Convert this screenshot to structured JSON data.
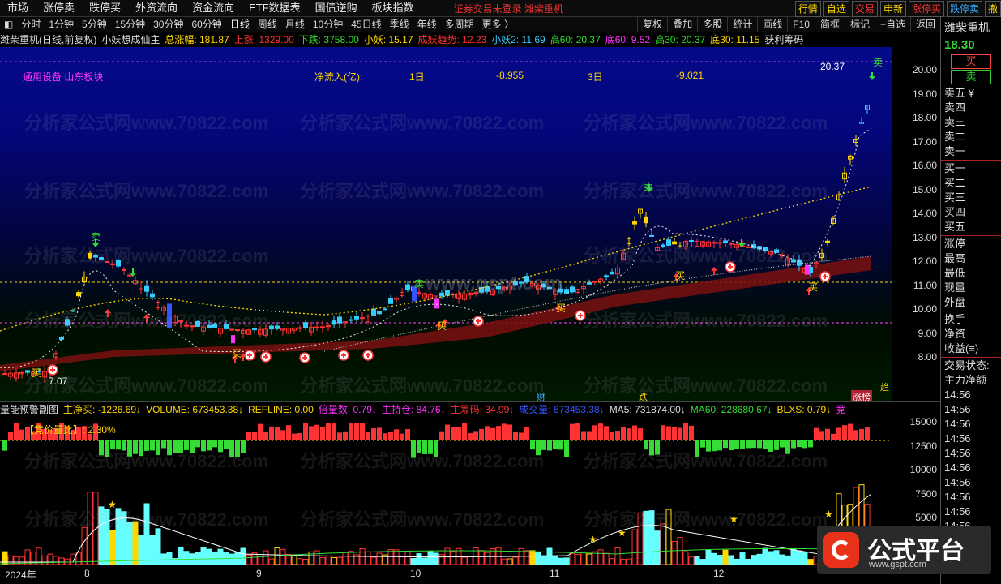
{
  "menubar": {
    "items": [
      "市场",
      "涨停卖",
      "跌停买",
      "外资流向",
      "资金流向",
      "ETF数据表",
      "国债逆购",
      "板块指数"
    ],
    "message": "证券交易未登录 潍柴重机",
    "right_tabs": [
      {
        "label": "行情",
        "color": "#ffd800"
      },
      {
        "label": "自选",
        "color": "#ffd800"
      },
      {
        "label": "交易",
        "color": "#ff3333"
      },
      {
        "label": "申新",
        "color": "#ffd800"
      },
      {
        "label": "涨停买",
        "color": "#ff3333"
      },
      {
        "label": "跌停卖",
        "color": "#33aaff"
      },
      {
        "label": "撤",
        "color": "#ffd800"
      }
    ]
  },
  "toolbar": {
    "items": [
      "分时",
      "1分钟",
      "5分钟",
      "15分钟",
      "30分钟",
      "60分钟",
      "日线",
      "周线",
      "月线",
      "10分钟",
      "45日线",
      "季线",
      "年线",
      "多周期",
      "更多 〉"
    ],
    "active": "日线",
    "right": [
      "复权",
      "叠加",
      "多股",
      "统计",
      "画线",
      "F10",
      "简框",
      "标记",
      "+自选",
      "返回"
    ]
  },
  "infobar": [
    {
      "text": "潍柴重机(日线,前复权)",
      "color": "#dddddd"
    },
    {
      "text": "小妖想成仙主",
      "color": "#dddddd"
    },
    {
      "text": "总涨幅: 181.87",
      "color": "#ffd800"
    },
    {
      "text": "上涨: 1329.00",
      "color": "#ff3333"
    },
    {
      "text": "下跌: 3758.00",
      "color": "#33dd33"
    },
    {
      "text": "小妖: 15.17",
      "color": "#ffd800"
    },
    {
      "text": "成妖趋势: 12.23",
      "color": "#ff3333"
    },
    {
      "text": "小妖2: 11.69",
      "color": "#33ccff"
    },
    {
      "text": "高60: 20.37",
      "color": "#33dd33"
    },
    {
      "text": "底60: 9.52",
      "color": "#ff33ff"
    },
    {
      "text": "高30: 20.37",
      "color": "#33dd33"
    },
    {
      "text": "底30: 11.15",
      "color": "#ffd800"
    },
    {
      "text": "获利筹码",
      "color": "#dddddd"
    }
  ],
  "main": {
    "sector_labels": [
      "通用设备",
      "山东板块"
    ],
    "flow_label": "净流入(亿):",
    "flow_1d_label": "1日",
    "flow_1d_value": "-8.955",
    "flow_3d_label": "3日",
    "flow_3d_value": "-9.021",
    "high_marker": "20.37",
    "low_marker": "7.07",
    "y_ticks": [
      "20.00",
      "19.00",
      "18.00",
      "17.00",
      "16.00",
      "15.00",
      "14.00",
      "13.00",
      "12.00",
      "11.00",
      "10.00",
      "9.00",
      "8.00"
    ],
    "event_labels": [
      "财",
      "跌",
      "涨榜",
      "趋"
    ],
    "watermark": "分析家公式网www.70822.com",
    "site_watermark": "www.gspt.com"
  },
  "subbar": [
    {
      "text": "量能预警副图",
      "color": "#dddddd"
    },
    {
      "text": "主净买: -1226.69↓",
      "color": "#ffd800"
    },
    {
      "text": "VOLUME: 673453.38↓",
      "color": "#ffd800"
    },
    {
      "text": "REFLINE: 0.00",
      "color": "#ffd800"
    },
    {
      "text": "倍量数: 0.79↓",
      "color": "#ff33ff"
    },
    {
      "text": "主持仓: 84.76↓",
      "color": "#ff33ff"
    },
    {
      "text": "主筹码: 34.99↓",
      "color": "#ff3333"
    },
    {
      "text": "成交量: 673453.38↓",
      "color": "#3355ff"
    },
    {
      "text": "MA5: 731874.00↓",
      "color": "#dddddd"
    },
    {
      "text": "MA60: 228680.67↓",
      "color": "#33dd33"
    },
    {
      "text": "BLXS: 0.79↓",
      "color": "#ffd800"
    },
    {
      "text": "竞",
      "color": "#ff33ff"
    }
  ],
  "sub": {
    "auction_label": "【竞价量比】: 2.30%",
    "y_ticks": [
      "15000",
      "12500",
      "10000",
      "7500",
      "5000"
    ]
  },
  "date_axis": [
    "2024年",
    "8",
    "9",
    "10",
    "11",
    "12"
  ],
  "right_panel": {
    "name": "潍柴重机",
    "price": "18.30",
    "buy_button": "买",
    "sell_button": "卖",
    "sell_levels": [
      "卖五 ¥",
      "卖四",
      "卖三",
      "卖二",
      "卖一"
    ],
    "buy_levels": [
      "买一",
      "买二",
      "买三",
      "买四",
      "买五"
    ],
    "stats": [
      "涨停",
      "最高",
      "最低",
      "现量",
      "外盘"
    ],
    "stats2": [
      "换手",
      "净资",
      "收益(≡)"
    ],
    "trade_state": "交易状态:",
    "main_amount": "主力净额",
    "times": [
      "14:56",
      "14:56",
      "14:56",
      "14:56",
      "14:56",
      "14:56",
      "14:56",
      "14:56",
      "14:56",
      "14:56"
    ]
  },
  "logo": {
    "text": "公式平台",
    "url": "www.gspt.com",
    "brand_color": "#e8331a"
  }
}
